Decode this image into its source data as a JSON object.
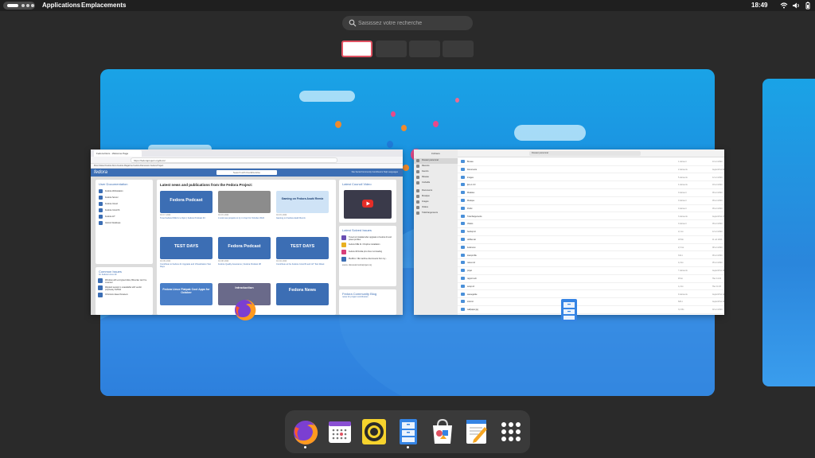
{
  "topbar": {
    "applications_label": "Applications",
    "places_label": "Emplacements",
    "clock": "18:49",
    "tray_icons": [
      "network-icon",
      "volume-icon",
      "battery-icon",
      "power-icon"
    ]
  },
  "search": {
    "placeholder": "Saisissez votre recherche"
  },
  "workspaces": {
    "count": 4,
    "active_index": 0
  },
  "windows": {
    "firefox": {
      "tab_title": "Fedora Docs - Welcome Page",
      "url": "https://fedoraproject.org/docs/",
      "bookmarks": "Most Visited   Fedora Docs   Fedora Magazine   Fedora Discussion   Fedora Project",
      "site_logo": "fedora",
      "site_search_placeholder": "Search with DuckDuckGo",
      "site_nav": "Site Social   Community   Contributors   Help   Languages",
      "user_docs_title": "User Documentation",
      "user_docs": [
        "Fedora Workstation",
        "Fedora Server",
        "Fedora Cloud",
        "Fedora CoreOS",
        "Fedora IoT",
        "Atomic Desktops"
      ],
      "common_issues_title": "Common Issues",
      "common_issues_subtitle": "for Fedora Linux 40",
      "common_issues": [
        "Windows with encrypted disks, BitLocker can't be mounted",
        "Wayland session is unavailable with vendor proprietary NVIDIA",
        "Chromium-based browsers"
      ],
      "news_heading": "Latest news and publications from the Fedora Project:",
      "news": [
        {
          "thumb": "Fedora Podcast",
          "date": "Oct 17, 2024",
          "caption": "Tune Fedora KDE for a Spin | Fedora Podcast 33"
        },
        {
          "thumb": "",
          "date": "Oct 15, 2024",
          "caption": "4 cool new projects to try in Copr for October 2024"
        },
        {
          "thumb": "Gaming on Fedora Asahi Remix",
          "date": "Oct 15, 2024",
          "caption": "Gaming on Fedora Asahi Remix"
        },
        {
          "thumb": "TEST DAYS",
          "date": "Oct 09, 2024",
          "caption": "Contribute to Fedora 41 Upgrade and Virtualization Test Days"
        },
        {
          "thumb": "Fedora Podcast",
          "date": "Oct 08, 2024",
          "caption": "Fedora Quality Assurance | Fedora Podcast 38"
        },
        {
          "thumb": "TEST DAYS",
          "date": "Oct 04, 2024",
          "caption": "Contribute at the Fedora CoreOS and IoT Test Week"
        },
        {
          "thumb": "Fedora Linux Flatpak Cool Apps for October",
          "date": "",
          "caption": ""
        },
        {
          "thumb": "Introduction",
          "date": "",
          "caption": ""
        },
        {
          "thumb": "Fedora News",
          "date": "",
          "caption": ""
        }
      ],
      "council_video_title": "Latest Council Video",
      "solved_issues_title": "Latest Solved Issues",
      "solved_issues": [
        "Tuned not installed after upgrade to Fedora 41 and power-profiles",
        "Fedora KDE 41 / Dropbox installation",
        "Fedora 40 Nvidia rpm driver not loading",
        "PlexBox / NE machine disconnects from my..."
      ],
      "solved_source": "source: discussion.fedoraproject.org",
      "blog_title": "Fedora Community Blog",
      "blog_subtitle": "news for project contributors"
    },
    "files": {
      "sidebar_title": "Fichiers",
      "sidebar_items": [
        "Dossier personnel",
        "Récents",
        "Favoris",
        "Réseau",
        "Corbeille",
        "Documents",
        "Musique",
        "Images",
        "Vidéos",
        "Téléchargements"
      ],
      "path": "Dossier personnel",
      "rows": [
        {
          "name": "Bureau",
          "size": "1 élément",
          "date": "10 oct 2024"
        },
        {
          "name": "Documents",
          "size": "2 éléments",
          "date": "Aujourd'hui 09:12"
        },
        {
          "name": "Images",
          "size": "5 éléments",
          "date": "12 oct 2024"
        },
        {
          "name": "jlsm-1.0.0",
          "size": "4 éléments",
          "date": "03 oct 2024"
        },
        {
          "name": "Modèles",
          "size": "0 élément",
          "date": "09 oct 2024"
        },
        {
          "name": "Musique",
          "size": "0 élément",
          "date": "09 oct 2024"
        },
        {
          "name": "Public",
          "size": "0 élément",
          "date": "09 oct 2024"
        },
        {
          "name": "Téléchargements",
          "size": "3 éléments",
          "date": "Aujourd'hui 17:05"
        },
        {
          "name": "Vidéos",
          "size": "0 élément",
          "date": "09 oct 2024"
        },
        {
          "name": "backup.txt",
          "size": "2,1 ko",
          "date": "12 oct 2024"
        },
        {
          "name": "dotfiles.tar",
          "size": "18 Mo",
          "date": "11 oct 2024"
        },
        {
          "name": "fedora.iso",
          "size": "2,3 Go",
          "date": "08 oct 2024"
        },
        {
          "name": "load-profile",
          "size": "312 o",
          "date": "06 oct 2024"
        },
        {
          "name": "notes.md",
          "size": "4,0 ko",
          "date": "05 oct 2024"
        },
        {
          "name": "projet",
          "size": "7 éléments",
          "date": "Aujourd'hui 16:40"
        },
        {
          "name": "rapport.odt",
          "size": "45 ko",
          "date": "Hier 14:22"
        },
        {
          "name": "setup.sh",
          "size": "1,2 ko",
          "date": "Hier 11:03"
        },
        {
          "name": "sauvegarde",
          "size": "9 éléments",
          "date": "Aujourd'hui 12:31"
        },
        {
          "name": "todo.txt",
          "size": "620 o",
          "date": "Aujourd'hui 10:15"
        },
        {
          "name": "wallpaper.jpg",
          "size": "3,4 Mo",
          "date": "02 oct 2024"
        }
      ]
    }
  },
  "dash": {
    "apps": [
      {
        "name": "firefox-icon",
        "running": true
      },
      {
        "name": "calendar-icon",
        "running": false
      },
      {
        "name": "rhythmbox-icon",
        "running": false
      },
      {
        "name": "files-icon",
        "running": true
      },
      {
        "name": "software-icon",
        "running": false
      },
      {
        "name": "text-editor-icon",
        "running": false
      },
      {
        "name": "app-grid-icon",
        "running": false
      }
    ]
  },
  "colors": {
    "topbar": "#1f1f1f",
    "background": "#2a2a2a",
    "active_workspace_border": "#e05262",
    "fedora_blue": "#3c6eb4"
  }
}
